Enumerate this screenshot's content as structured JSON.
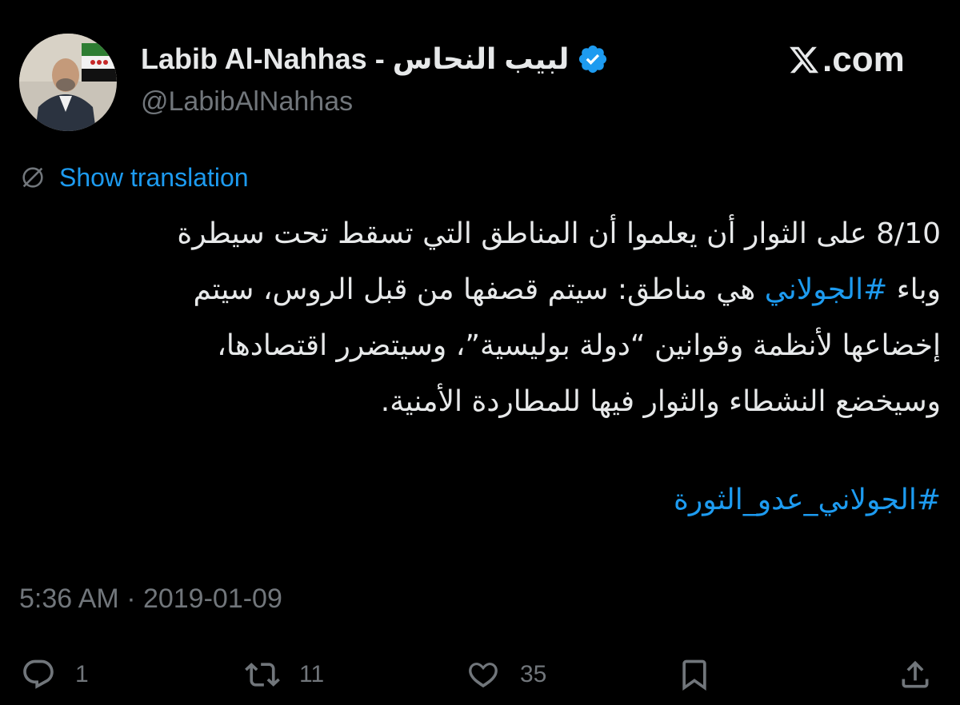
{
  "profile": {
    "display_name": "Labib Al-Nahhas - لبيب النحاس",
    "handle": "@LabibAlNahhas",
    "avatar_icon": "profile-photo"
  },
  "brand": {
    "label": ".com",
    "icon": "x-logo-icon"
  },
  "translation": {
    "label": "Show translation"
  },
  "tweet": {
    "lines": [
      "8/10 على الثوار أن يعلموا أن المناطق التي تسقط تحت سيطرة",
      "وباء ",
      " هي مناطق: سيتم قصفها من قبل الروس، سيتم",
      "إخضاعها لأنظمة وقوانين “دولة بوليسية”، وسيتضرر اقتصادها،",
      "وسيخضع النشطاء والثوار فيها للمطاردة الأمنية."
    ],
    "inline_hashtag": "#الجولاني",
    "footer_hashtag": "#الجولاني_عدو_الثورة",
    "timestamp": "5:36 AM · 2019-01-09"
  },
  "actions": {
    "replies": "1",
    "reposts": "11",
    "likes": "35"
  },
  "colors": {
    "background": "#000000",
    "text": "#e7e9ea",
    "muted": "#71767b",
    "link": "#1d9bf0",
    "verified": "#1d9bf0"
  }
}
